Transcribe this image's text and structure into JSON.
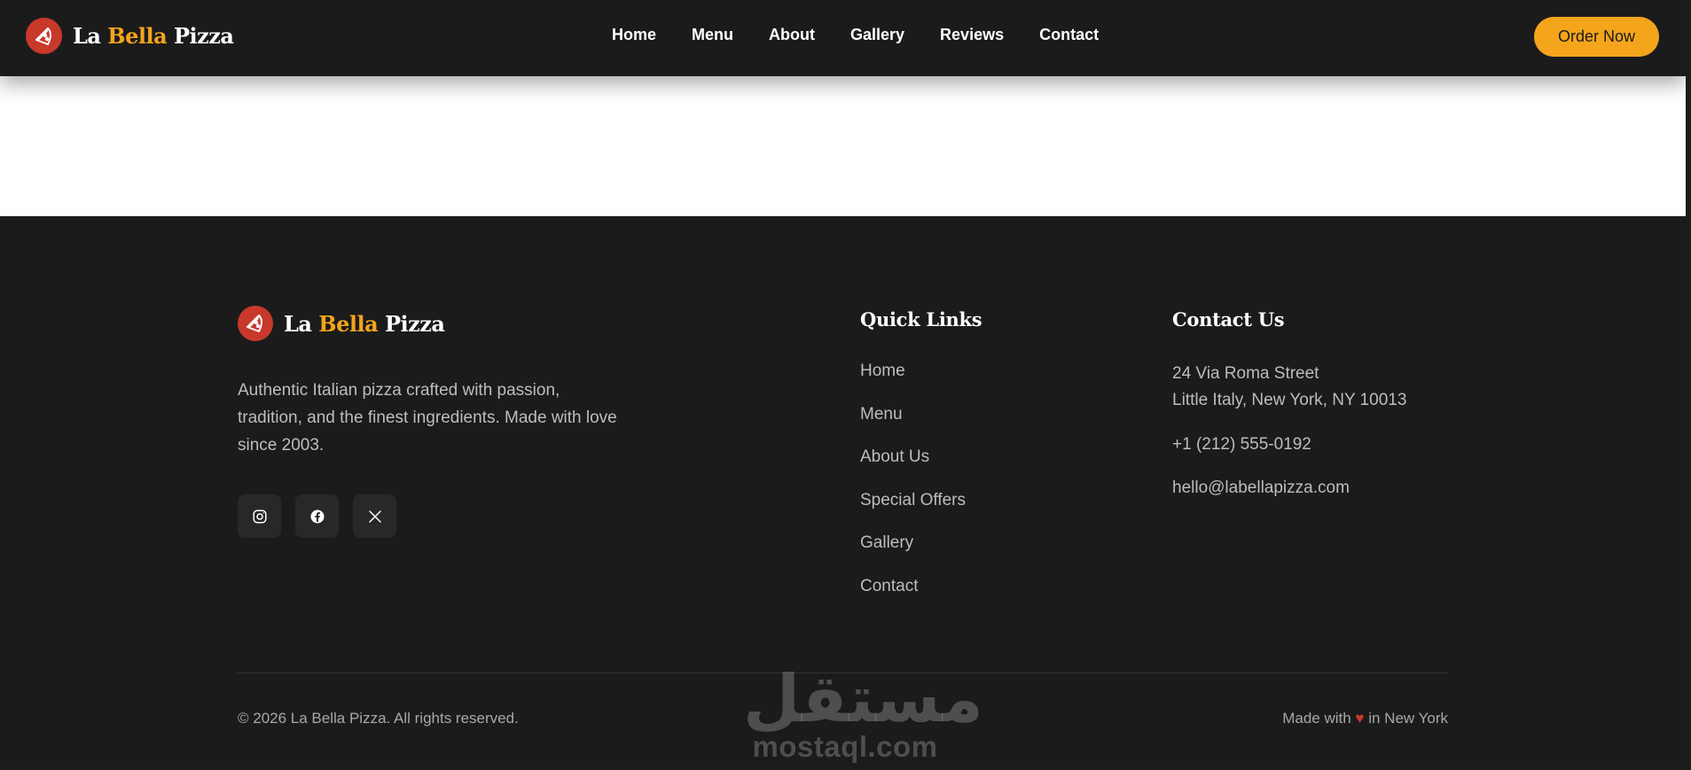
{
  "header": {
    "brand": {
      "name_part1": "La ",
      "name_accent": "Bella",
      "name_part2": " Pizza"
    },
    "nav": [
      {
        "label": "Home"
      },
      {
        "label": "Menu"
      },
      {
        "label": "About"
      },
      {
        "label": "Gallery"
      },
      {
        "label": "Reviews"
      },
      {
        "label": "Contact"
      }
    ],
    "order_button": "Order Now"
  },
  "footer": {
    "brand": {
      "name_part1": "La ",
      "name_accent": "Bella",
      "name_part2": " Pizza"
    },
    "about_text": "Authentic Italian pizza crafted with passion, tradition, and the finest ingredients. Made with love since 2003.",
    "socials": [
      {
        "icon": "instagram-icon"
      },
      {
        "icon": "facebook-icon"
      },
      {
        "icon": "x-icon"
      }
    ],
    "quick_links": {
      "title": "Quick Links",
      "items": [
        {
          "label": "Home"
        },
        {
          "label": "Menu"
        },
        {
          "label": "About Us"
        },
        {
          "label": "Special Offers"
        },
        {
          "label": "Gallery"
        },
        {
          "label": "Contact"
        }
      ]
    },
    "contact": {
      "title": "Contact Us",
      "address_line1": "24 Via Roma Street",
      "address_line2": "Little Italy, New York, NY 10013",
      "phone": "+1 (212) 555-0192",
      "email": "hello@labellapizza.com"
    },
    "copyright": "© 2026 La Bella Pizza. All rights reserved.",
    "made_with_prefix": "Made with ",
    "made_with_heart": "♥",
    "made_with_suffix": " in New York"
  },
  "watermark": {
    "arabic": "مستقل",
    "latin": "mostaql.com"
  },
  "colors": {
    "accent": "#f4a51c",
    "logo_red": "#c8392b",
    "background_dark": "#1b1b1b"
  }
}
